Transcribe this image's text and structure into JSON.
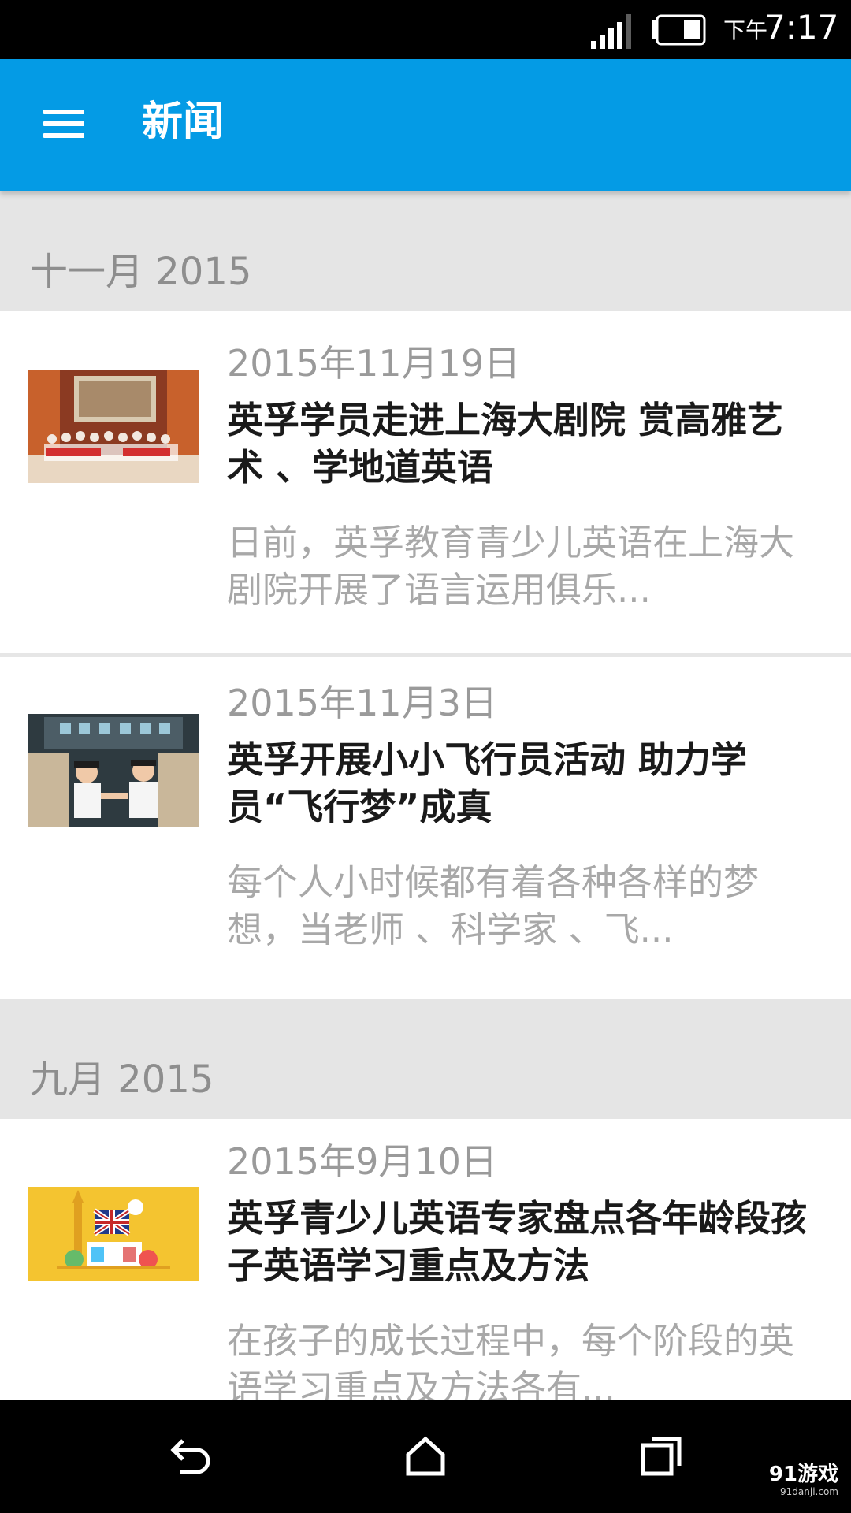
{
  "status_bar": {
    "time_prefix": "下午",
    "time": "7:17",
    "signal_icon": "signal-bars-icon",
    "battery_icon": "battery-icon"
  },
  "app_bar": {
    "title": "新闻",
    "menu_icon": "hamburger-menu-icon",
    "color": "#049be5"
  },
  "sections": [
    {
      "month": "十一月 2015",
      "articles": [
        {
          "date": "2015年11月19日",
          "title": "英孚学员走进上海大剧院 赏高雅艺术 、学地道英语",
          "snippet": "日前，英孚教育青少儿英语在上海大剧院开展了语言运用俱乐..."
        },
        {
          "date": "2015年11月3日",
          "title": "英孚开展小小飞行员活动 助力学员“飞行梦”成真",
          "snippet": "每个人小时候都有着各种各样的梦想，当老师 、科学家 、飞..."
        }
      ]
    },
    {
      "month": "九月 2015",
      "articles": [
        {
          "date": "2015年9月10日",
          "title": "英孚青少儿英语专家盘点各年龄段孩子英语学习重点及方法",
          "snippet": "在孩子的成长过程中，每个阶段的英语学习重点及方法各有..."
        }
      ]
    }
  ],
  "nav_bar": {
    "back_icon": "back-arrow-icon",
    "home_icon": "home-icon",
    "recent_icon": "recent-apps-icon"
  },
  "watermark": {
    "main": "91游戏",
    "sub": "91danji.com"
  }
}
